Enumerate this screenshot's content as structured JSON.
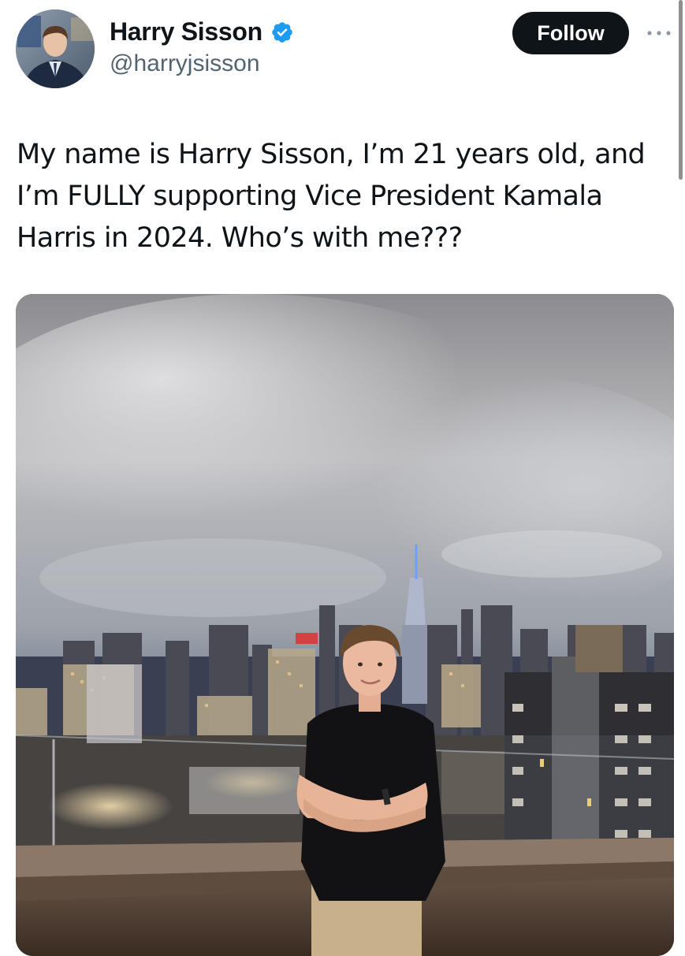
{
  "author": {
    "display_name": "Harry Sisson",
    "handle": "@harryjsisson",
    "verified": true,
    "verified_color": "#1d9bf0",
    "avatar_icon": "profile-photo"
  },
  "actions": {
    "follow_label": "Follow",
    "more_icon": "ellipsis-icon"
  },
  "tweet": {
    "text": "My name is Harry Sisson, I’m 21 years old, and I’m FULLY supporting Vice President Kamala Harris in 2024. Who’s with me???"
  },
  "media": {
    "type": "photo"
  },
  "colors": {
    "text": "#0f1419",
    "secondary_text": "#536471",
    "follow_bg": "#0f1419",
    "follow_text": "#ffffff"
  }
}
